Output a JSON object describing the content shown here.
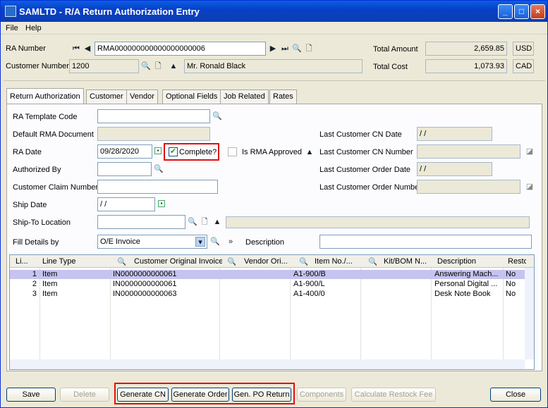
{
  "window": {
    "title": "SAMLTD - R/A Return Authorization Entry",
    "minimize": "_",
    "maximize": "□",
    "close": "×"
  },
  "menu": {
    "file": "File",
    "help": "Help"
  },
  "header": {
    "ra_number_label": "RA Number",
    "ra_number": "RMA000000000000000000006",
    "customer_number_label": "Customer Number",
    "customer_number": "1200",
    "customer_name": "Mr. Ronald Black",
    "total_amount_label": "Total Amount",
    "total_amount": "2,659.85",
    "total_amount_currency": "USD",
    "total_cost_label": "Total Cost",
    "total_cost": "1,073.93",
    "total_cost_currency": "CAD"
  },
  "tabs": [
    "Return Authorization",
    "Customer",
    "Vendor",
    "Optional Fields",
    "Job Related",
    "Rates"
  ],
  "form": {
    "ra_template_code_label": "RA Template Code",
    "ra_template_code": "",
    "default_rma_label": "Default RMA Document",
    "ra_date_label": "RA Date",
    "ra_date": "09/28/2020",
    "complete_label": "Complete?",
    "is_rma_approved_label": "Is RMA Approved",
    "authorized_by_label": "Authorized By",
    "customer_claim_label": "Customer Claim Number",
    "ship_date_label": "Ship Date",
    "ship_date": " / /",
    "ship_to_label": "Ship-To Location",
    "fill_details_label": "Fill Details by",
    "fill_details_value": "O/E Invoice",
    "description_label": "Description",
    "last_cn_date_label": "Last Customer CN Date",
    "last_cn_date": " / /",
    "last_cn_number_label": "Last Customer CN Number",
    "last_order_date_label": "Last Customer Order Date",
    "last_order_date": " / /",
    "last_order_number_label": "Last Customer Order Number"
  },
  "grid": {
    "columns": [
      "Li...",
      "Line Type",
      "Customer Original Invoice",
      "Vendor Ori...",
      "Item No./...",
      "Kit/BOM N...",
      "Description",
      "Resto"
    ],
    "rows": [
      {
        "line": "1",
        "type": "Item",
        "invoice": "IN0000000000061",
        "vendor": "",
        "item": "A1-900/B",
        "kit": "",
        "desc": "Answering Mach...",
        "resto": "No"
      },
      {
        "line": "2",
        "type": "Item",
        "invoice": "IN0000000000061",
        "vendor": "",
        "item": "A1-900/L",
        "kit": "",
        "desc": "Personal Digital ...",
        "resto": "No"
      },
      {
        "line": "3",
        "type": "Item",
        "invoice": "IN0000000000063",
        "vendor": "",
        "item": "A1-400/0",
        "kit": "",
        "desc": "Desk Note Book",
        "resto": "No"
      }
    ]
  },
  "buttons": {
    "save": "Save",
    "delete": "Delete",
    "generate_cn": "Generate CN",
    "generate_order": "Generate Order",
    "gen_po_return": "Gen. PO Return",
    "components": "Components",
    "calc_restock": "Calculate Restock Fee",
    "close": "Close"
  },
  "colors": {
    "selected_row": "#c5c4f0",
    "highlight_box": "#e01010",
    "title_bar": "#0840c8"
  }
}
